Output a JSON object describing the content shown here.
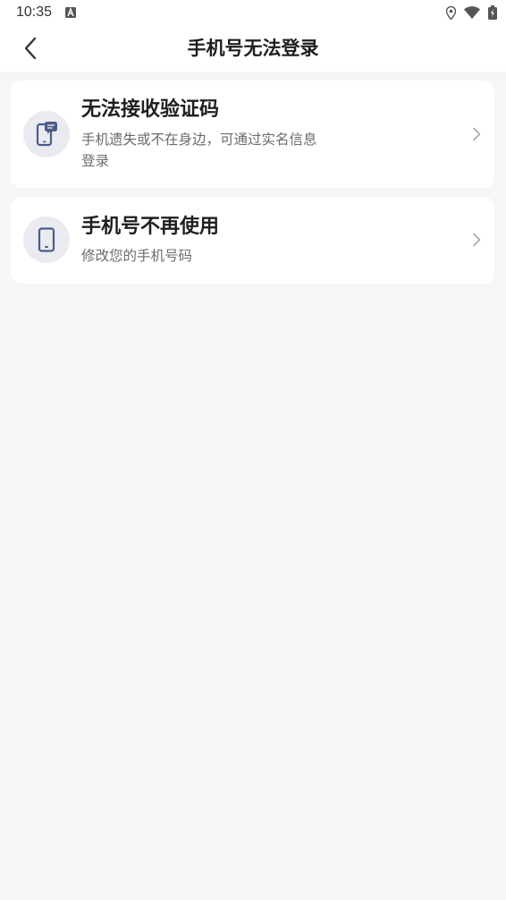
{
  "status_bar": {
    "time": "10:35",
    "icons": [
      "a-notification-icon",
      "location-icon",
      "wifi-icon",
      "battery-charging-icon"
    ]
  },
  "header": {
    "title": "手机号无法登录",
    "back_icon": "chevron-left-icon"
  },
  "options": [
    {
      "icon": "phone-message-icon",
      "title": "无法接收验证码",
      "description": "手机遗失或不在身边，可通过实名信息登录",
      "chevron_icon": "chevron-right-icon"
    },
    {
      "icon": "phone-icon",
      "title": "手机号不再使用",
      "description": "修改您的手机号码",
      "chevron_icon": "chevron-right-icon"
    }
  ],
  "colors": {
    "background": "#f6f6f6",
    "card": "#ffffff",
    "icon_circle": "#e9ebf1",
    "icon_color": "#4a5d85",
    "title_text": "#1f1f1f",
    "secondary_text": "#6b6b6b"
  }
}
